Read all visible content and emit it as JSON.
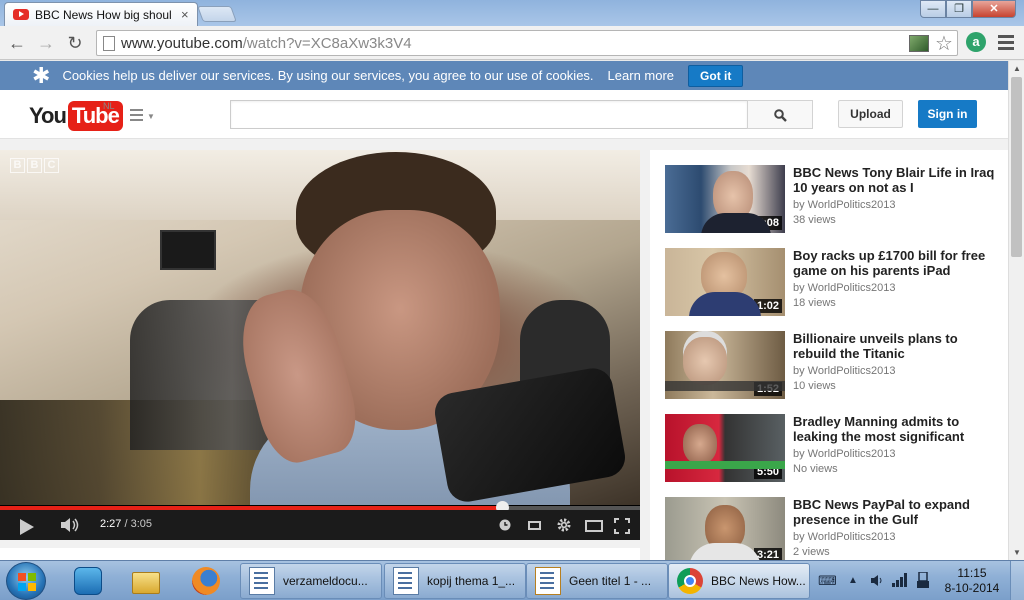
{
  "browser": {
    "tab_title": "BBC News How big shoul",
    "tab_close": "×",
    "window_buttons": {
      "minimize": "—",
      "maximize": "❐",
      "close": "✕"
    },
    "nav": {
      "back": "←",
      "forward": "→",
      "reload": "↻"
    },
    "url_host": "www.youtube.com",
    "url_rest": "/watch?v=XC8aXw3k3V4",
    "star": "☆",
    "extension_letter": "a"
  },
  "cookie_bar": {
    "text": "Cookies help us deliver our services. By using our services, you agree to our use of cookies.",
    "learn_more": "Learn more",
    "got_it": "Got it",
    "icon": "✱"
  },
  "masthead": {
    "logo_you": "You",
    "logo_tube": "Tube",
    "logo_region": "NL",
    "search_placeholder": "",
    "upload_label": "Upload",
    "signin_label": "Sign in"
  },
  "player": {
    "watermark": [
      "B",
      "B",
      "C"
    ],
    "current_time": "2:27",
    "separator": " / ",
    "duration": "3:05",
    "progress_fraction": 0.784
  },
  "recommendations": [
    {
      "title": "BBC News Tony Blair Life in Iraq 10 years on not as I",
      "by": "by WorldPolitics2013",
      "views": "38 views",
      "duration": "5:08"
    },
    {
      "title": "Boy racks up £1700 bill for free game on his parents iPad",
      "by": "by WorldPolitics2013",
      "views": "18 views",
      "duration": "1:02"
    },
    {
      "title": "Billionaire unveils plans to rebuild the Titanic",
      "by": "by WorldPolitics2013",
      "views": "10 views",
      "duration": "1:52"
    },
    {
      "title": "Bradley Manning admits to leaking the most significant",
      "by": "by WorldPolitics2013",
      "views": "No views",
      "duration": "5:50"
    },
    {
      "title": "BBC News PayPal to expand presence in the Gulf",
      "by": "by WorldPolitics2013",
      "views": "2 views",
      "duration": "3:21"
    }
  ],
  "taskbar": {
    "items": [
      {
        "label": "verzameldocu...",
        "icon": "document-icon"
      },
      {
        "label": "kopij thema 1_...",
        "icon": "document-icon"
      },
      {
        "label": "Geen titel 1 - ...",
        "icon": "draw-document-icon"
      },
      {
        "label": "BBC News How...",
        "icon": "chrome-icon"
      }
    ],
    "time": "11:15",
    "date": "8-10-2014",
    "tray_up": "▲"
  }
}
